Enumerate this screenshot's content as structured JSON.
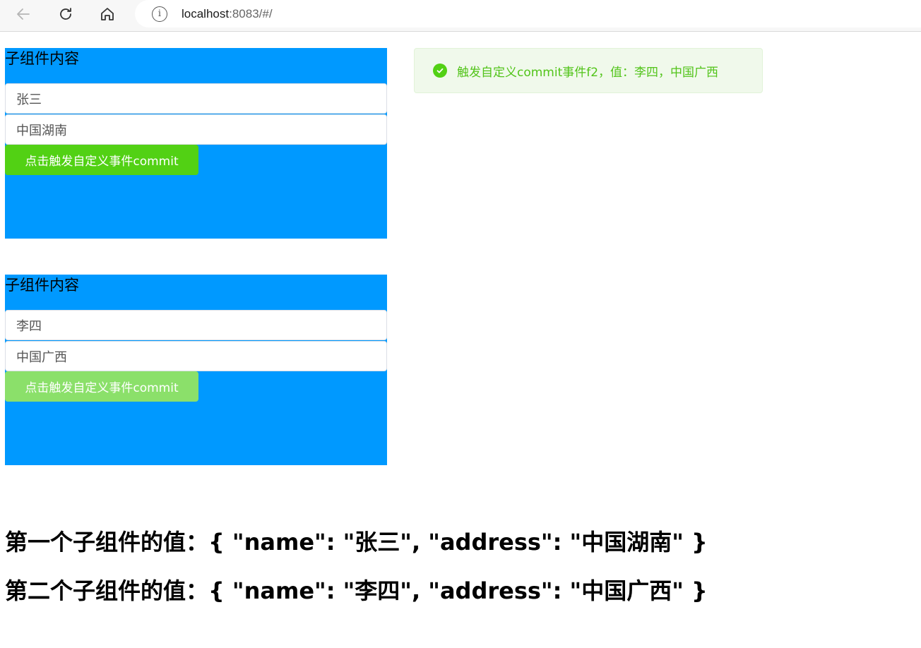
{
  "browser": {
    "url_host": "localhost",
    "url_rest": ":8083/#/"
  },
  "panels": [
    {
      "title": "子组件内容",
      "name_value": "张三",
      "address_value": "中国湖南",
      "button_label": "点击触发自定义事件commit"
    },
    {
      "title": "子组件内容",
      "name_value": "李四",
      "address_value": "中国广西",
      "button_label": "点击触发自定义事件commit"
    }
  ],
  "toast": {
    "message": "触发自定义commit事件f2，值：李四，中国广西",
    "icon": "check-circle-icon",
    "color": "#52c41a"
  },
  "results": [
    "第一个子组件的值：{ \"name\": \"张三\", \"address\": \"中国湖南\" }",
    "第二个子组件的值：{ \"name\": \"李四\", \"address\": \"中国广西\" }"
  ],
  "colors": {
    "panel_bg": "#0099ff",
    "button_primary": "#52d114",
    "button_light": "#8be06a"
  }
}
